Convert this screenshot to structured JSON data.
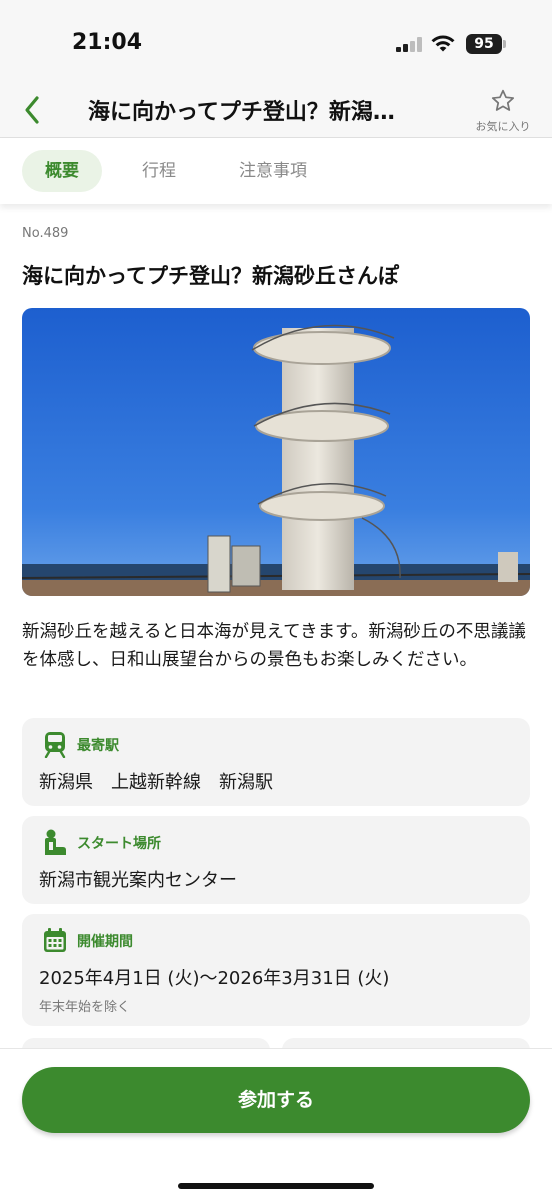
{
  "status": {
    "time": "21:04",
    "battery": "95"
  },
  "nav": {
    "title": "海に向かってプチ登山？新潟…",
    "favorite_label": "お気に入り"
  },
  "tabs": [
    {
      "label": "概要",
      "active": true
    },
    {
      "label": "行程"
    },
    {
      "label": "注意事項"
    }
  ],
  "route": {
    "number": "No.489",
    "title": "海に向かってプチ登山？新潟砂丘さんぽ",
    "description": "新潟砂丘を越えると日本海が見えてきます。新潟砂丘の不思議議を体感し、日和山展望台からの景色もお楽しみください。"
  },
  "info": {
    "station": {
      "label": "最寄駅",
      "value": "新潟県　上越新幹線　新潟駅",
      "icon": "train-icon"
    },
    "start": {
      "label": "スタート場所",
      "value": "新潟市観光案内センター",
      "icon": "walker-icon"
    },
    "period": {
      "label": "開催期間",
      "value": "2025年4月1日 (火)～2026年3月31日 (火)",
      "note": "年末年始を除く",
      "icon": "calendar-icon"
    }
  },
  "actions": {
    "join_label": "参加する"
  },
  "colors": {
    "accent": "#3c8a2e",
    "tab_active_bg": "#eaf3e6",
    "card_bg": "#f3f3f3"
  }
}
